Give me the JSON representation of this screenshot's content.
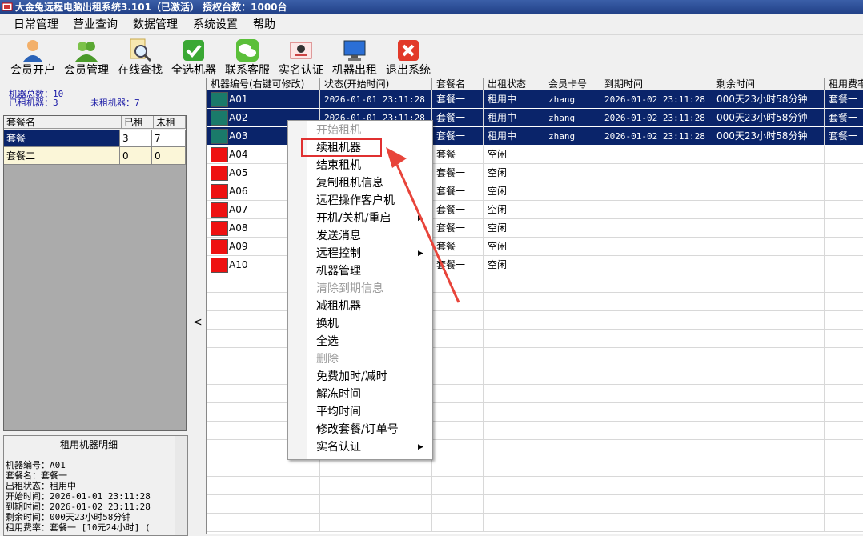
{
  "window": {
    "title": "大金兔远程电脑出租系统3.101（已激活） 授权台数：1000台"
  },
  "menu": [
    "日常管理",
    "营业查询",
    "数据管理",
    "系统设置",
    "帮助"
  ],
  "toolbar": [
    {
      "label": "会员开户",
      "icon": "user-add-icon"
    },
    {
      "label": "会员管理",
      "icon": "users-icon"
    },
    {
      "label": "在线查找",
      "icon": "search-icon"
    },
    {
      "label": "全选机器",
      "icon": "check-icon"
    },
    {
      "label": "联系客服",
      "icon": "wechat-icon"
    },
    {
      "label": "实名认证",
      "icon": "id-card-icon"
    },
    {
      "label": "机器出租",
      "icon": "monitor-icon"
    },
    {
      "label": "退出系统",
      "icon": "exit-icon"
    }
  ],
  "stats": {
    "total": "机器总数：10",
    "rented": "已租机器：3",
    "unrented": "未租机器：7"
  },
  "packages": {
    "headers": [
      "套餐名",
      "已租",
      "未租"
    ],
    "rows": [
      {
        "name": "套餐一",
        "rented": "3",
        "free": "7"
      },
      {
        "name": "套餐二",
        "rented": "0",
        "free": "0"
      }
    ]
  },
  "detail": {
    "title": "租用机器明细",
    "lines": [
      "机器编号：A01",
      "套餐名：套餐一",
      "出租状态：租用中",
      "开始时间：2026-01-01 23:11:28",
      "到期时间：2026-01-02 23:11:28",
      "剩余时间：000天23小时58分钟",
      "租用费率：套餐一 [10元24小时] ("
    ]
  },
  "splitter": {
    "arrow": "<"
  },
  "grid": {
    "headers": [
      "机器编号(右键可修改)",
      "状态(开始时间)",
      "套餐名",
      "出租状态",
      "会员卡号",
      "到期时间",
      "剩余时间",
      "租用费率"
    ],
    "rows": [
      {
        "id": "A01",
        "start": "2026-01-01 23:11:28",
        "pkg": "套餐一",
        "status": "租用中",
        "card": "zhang",
        "expire": "2026-01-02 23:11:28",
        "remain": "000天23小时58分钟",
        "rate": "套餐一"
      },
      {
        "id": "A02",
        "start": "2026-01-01 23:11:28",
        "pkg": "套餐一",
        "status": "租用中",
        "card": "zhang",
        "expire": "2026-01-02 23:11:28",
        "remain": "000天23小时58分钟",
        "rate": "套餐一"
      },
      {
        "id": "A03",
        "start": "2026-01-01 23:11:28",
        "pkg": "套餐一",
        "status": "租用中",
        "card": "zhang",
        "expire": "2026-01-02 23:11:28",
        "remain": "000天23小时58分钟",
        "rate": "套餐一"
      },
      {
        "id": "A04",
        "start": "",
        "pkg": "套餐一",
        "status": "空闲",
        "card": "",
        "expire": "",
        "remain": "",
        "rate": ""
      },
      {
        "id": "A05",
        "start": "",
        "pkg": "套餐一",
        "status": "空闲",
        "card": "",
        "expire": "",
        "remain": "",
        "rate": ""
      },
      {
        "id": "A06",
        "start": "",
        "pkg": "套餐一",
        "status": "空闲",
        "card": "",
        "expire": "",
        "remain": "",
        "rate": ""
      },
      {
        "id": "A07",
        "start": "",
        "pkg": "套餐一",
        "status": "空闲",
        "card": "",
        "expire": "",
        "remain": "",
        "rate": ""
      },
      {
        "id": "A08",
        "start": "",
        "pkg": "套餐一",
        "status": "空闲",
        "card": "",
        "expire": "",
        "remain": "",
        "rate": ""
      },
      {
        "id": "A09",
        "start": "",
        "pkg": "套餐一",
        "status": "空闲",
        "card": "",
        "expire": "",
        "remain": "",
        "rate": ""
      },
      {
        "id": "A10",
        "start": "",
        "pkg": "套餐一",
        "status": "空闲",
        "card": "",
        "expire": "",
        "remain": "",
        "rate": ""
      }
    ]
  },
  "context_menu": [
    {
      "label": "开始租机",
      "disabled": true
    },
    {
      "label": "续租机器",
      "highlighted": true
    },
    {
      "label": "结束租机"
    },
    {
      "label": "复制租机信息"
    },
    {
      "label": "远程操作客户机"
    },
    {
      "label": "开机/关机/重启",
      "submenu": true
    },
    {
      "label": "发送消息"
    },
    {
      "label": "远程控制",
      "submenu": true
    },
    {
      "label": "机器管理"
    },
    {
      "label": "清除到期信息",
      "disabled": true
    },
    {
      "label": "减租机器"
    },
    {
      "label": "换机"
    },
    {
      "label": "全选"
    },
    {
      "label": "删除",
      "disabled": true
    },
    {
      "label": "免费加时/减时"
    },
    {
      "label": "解冻时间"
    },
    {
      "label": "平均时间"
    },
    {
      "label": "修改套餐/订单号"
    },
    {
      "label": "实名认证",
      "submenu": true
    }
  ],
  "colors": {
    "selection": "#0a246a",
    "rented_monitor": "#1a7a6a",
    "idle_monitor": "#ee1111",
    "callout": "#e03030",
    "pkg_selected": "#0a246a",
    "pkg_alt": "#fbf6d8"
  }
}
